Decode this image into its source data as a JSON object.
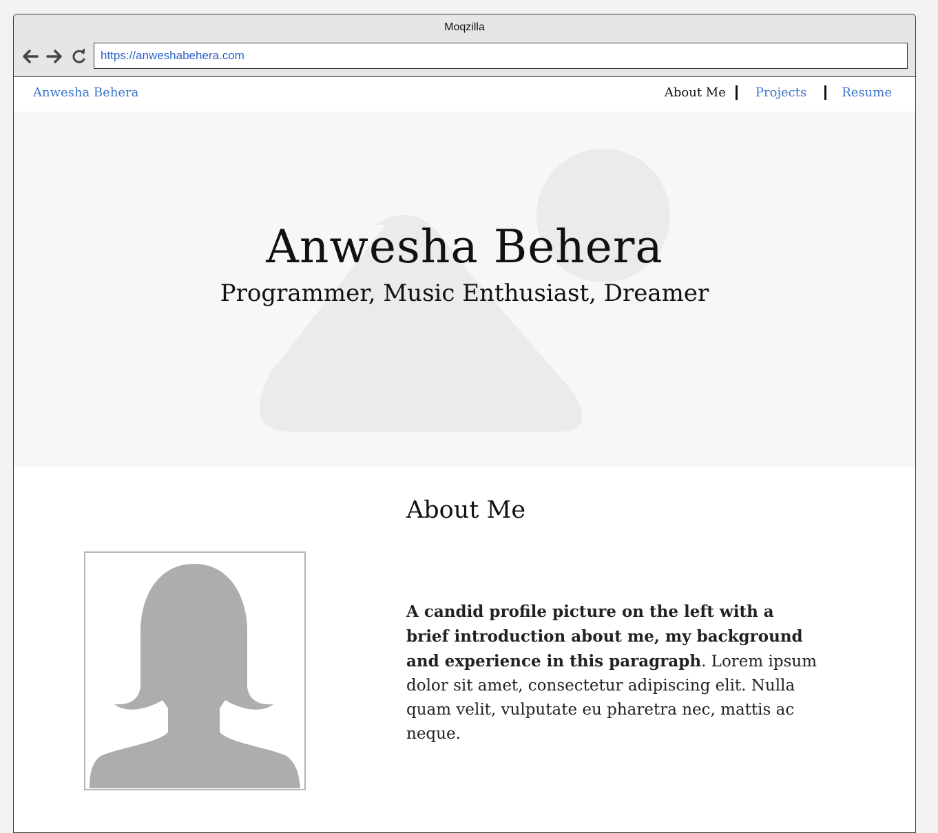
{
  "window": {
    "title": "Moqzilla"
  },
  "browser": {
    "url": "https://anweshabehera.com",
    "icons": [
      "back-arrow-icon",
      "forward-arrow-icon",
      "reload-icon"
    ]
  },
  "nav": {
    "brand": "Anwesha Behera",
    "links": [
      {
        "label": "About Me",
        "active": true
      },
      {
        "label": "Projects",
        "active": false
      },
      {
        "label": "Resume",
        "active": false
      }
    ]
  },
  "hero": {
    "name": "Anwesha Behera",
    "tagline": "Programmer, Music Enthusiast, Dreamer",
    "background_icon": "image-placeholder-icon"
  },
  "about": {
    "title": "About Me",
    "photo_icon": "female-avatar-placeholder-icon",
    "bio_bold": "A candid profile picture on the left with a brief introduction about me, my background and experience in this paragraph",
    "bio_rest": ". Lorem ipsum dolor sit amet, consectetur adipiscing elit. Nulla quam velit, vulputate eu pharetra nec, mattis ac neque."
  },
  "colors": {
    "link": "#3b73c9",
    "url_text": "#2a62c9",
    "hero_bg": "#f7f7f7",
    "placeholder": "#ebebeb",
    "avatar": "#adadad"
  }
}
